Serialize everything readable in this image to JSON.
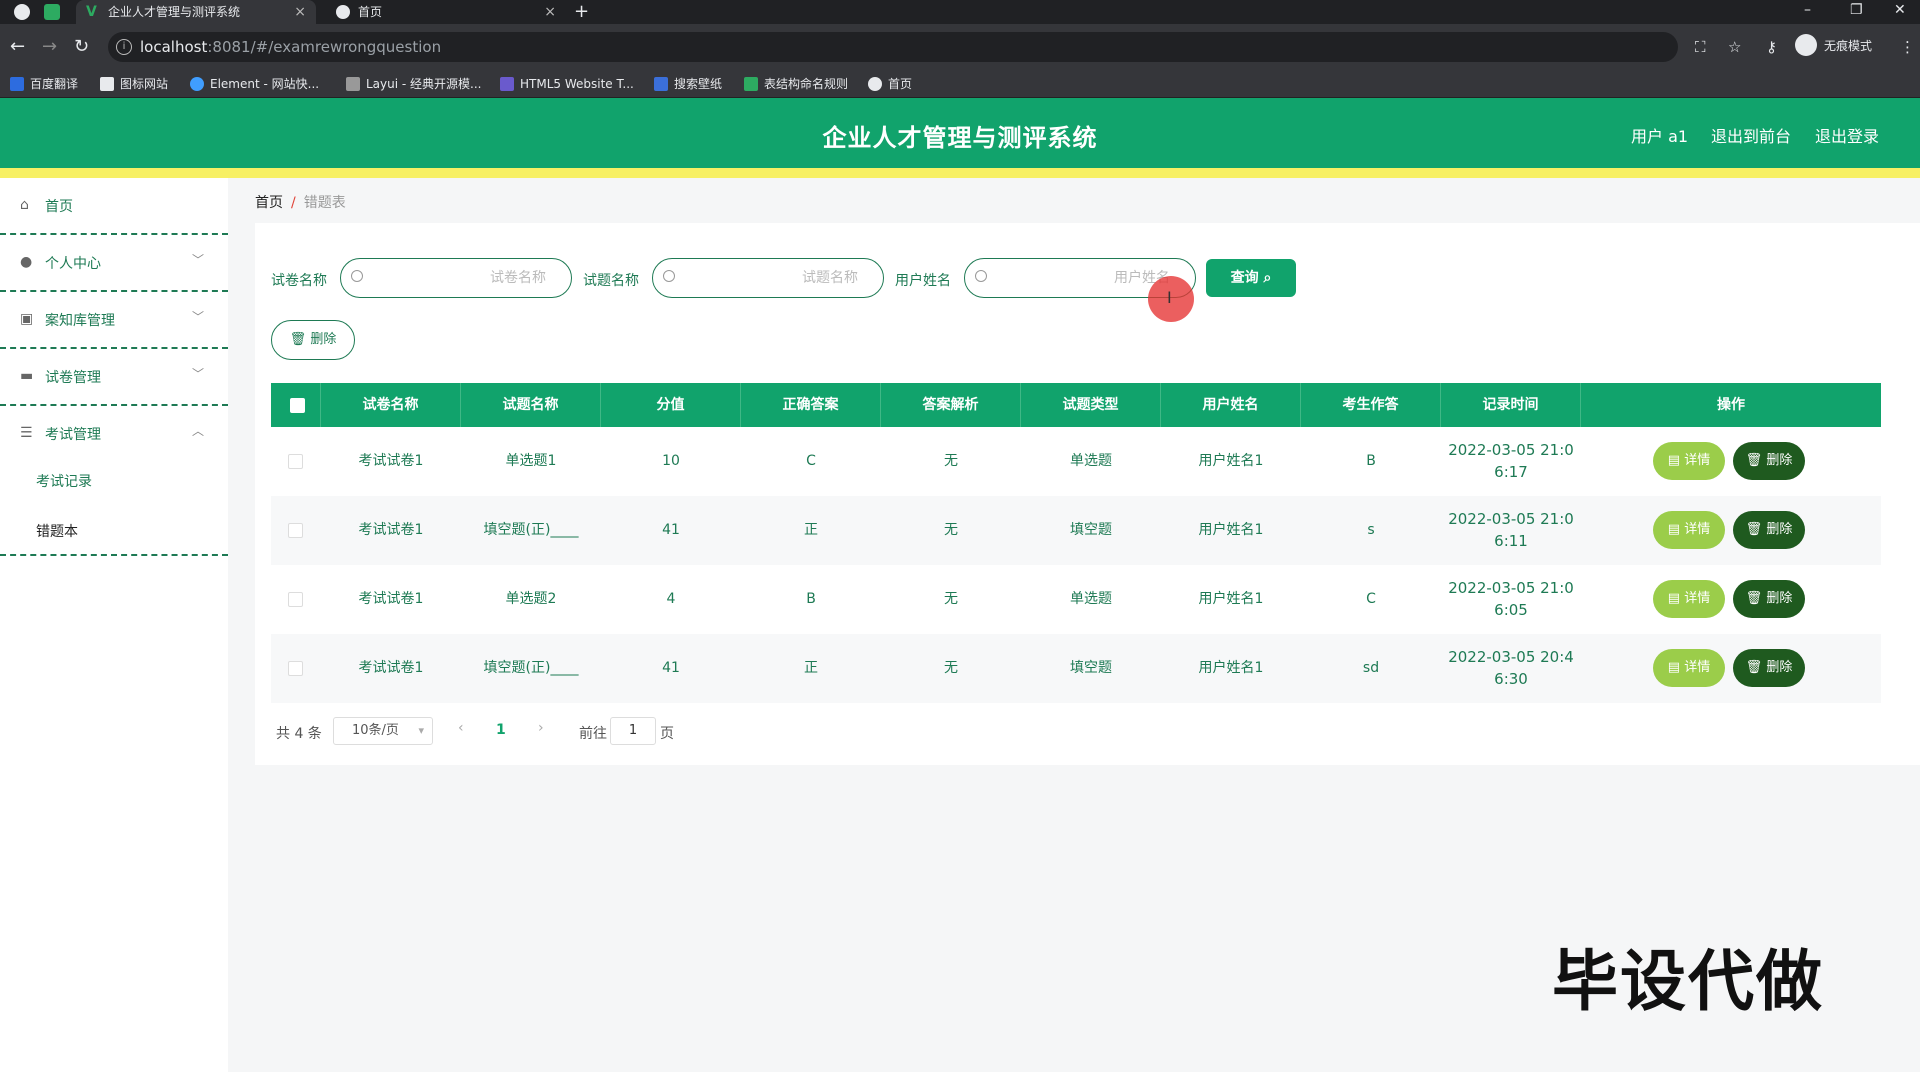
{
  "browser": {
    "tabs": [
      {
        "label": "企业人才管理与测评系统",
        "close": "×"
      },
      {
        "label": "首页",
        "close": "×"
      }
    ],
    "new_tab": "+",
    "url_host": "localhost",
    "url_rest": ":8081/#/examrewrongquestion",
    "incognito_label": "无痕模式",
    "bookmarks": [
      "百度翻译",
      "图标网站",
      "Element - 网站快...",
      "Layui - 经典开源模...",
      "HTML5 Website T...",
      "搜索壁纸",
      "表结构命名规则",
      "首页"
    ]
  },
  "header": {
    "title": "企业人才管理与测评系统",
    "user": "用户 a1",
    "back_front": "退出到前台",
    "logout": "退出登录"
  },
  "sidebar": {
    "items": [
      {
        "label": "首页",
        "icon": "home-icon"
      },
      {
        "label": "个人中心",
        "icon": "user-icon",
        "chevron": "﹀"
      },
      {
        "label": "案知库管理",
        "icon": "clipboard-icon",
        "chevron": "﹀"
      },
      {
        "label": "试卷管理",
        "icon": "folder-icon",
        "chevron": "﹀"
      },
      {
        "label": "考试管理",
        "icon": "sliders-icon",
        "chevron": "︿"
      }
    ],
    "sub_items": [
      "考试记录",
      "错题本"
    ]
  },
  "breadcrumb": {
    "home": "首页",
    "sep": "/",
    "current": "错题表"
  },
  "filters": [
    {
      "label": "试卷名称",
      "placeholder": "试卷名称"
    },
    {
      "label": "试题名称",
      "placeholder": "试题名称"
    },
    {
      "label": "用户姓名",
      "placeholder": "用户姓名"
    }
  ],
  "buttons": {
    "query": "查询",
    "batch_delete": "删除",
    "detail": "详情",
    "delete": "删除"
  },
  "table": {
    "columns": [
      "试卷名称",
      "试题名称",
      "分值",
      "正确答案",
      "答案解析",
      "试题类型",
      "用户姓名",
      "考生作答",
      "记录时间",
      "操作"
    ],
    "rows": [
      {
        "paper": "考试试卷1",
        "question": "单选题1",
        "score": "10",
        "answer": "C",
        "analysis": "无",
        "type": "单选题",
        "user": "用户姓名1",
        "response": "B",
        "time1": "2022-03-05 21:0",
        "time2": "6:17"
      },
      {
        "paper": "考试试卷1",
        "question": "填空题(正)____",
        "score": "41",
        "answer": "正",
        "analysis": "无",
        "type": "填空题",
        "user": "用户姓名1",
        "response": "s",
        "time1": "2022-03-05 21:0",
        "time2": "6:11"
      },
      {
        "paper": "考试试卷1",
        "question": "单选题2",
        "score": "4",
        "answer": "B",
        "analysis": "无",
        "type": "单选题",
        "user": "用户姓名1",
        "response": "C",
        "time1": "2022-03-05 21:0",
        "time2": "6:05"
      },
      {
        "paper": "考试试卷1",
        "question": "填空题(正)____",
        "score": "41",
        "answer": "正",
        "analysis": "无",
        "type": "填空题",
        "user": "用户姓名1",
        "response": "sd",
        "time1": "2022-03-05 20:4",
        "time2": "6:30"
      }
    ]
  },
  "pagination": {
    "total": "共 4 条",
    "page_size": "10条/页",
    "current": "1",
    "goto_label": "前往",
    "goto_value": "1",
    "page_suffix": "页"
  },
  "watermark": "毕设代做",
  "colors": {
    "primary": "#11a36c",
    "accent_bar": "#f7f064",
    "detail_btn": "#9bcd4a",
    "delete_btn": "#1f5a1f"
  }
}
